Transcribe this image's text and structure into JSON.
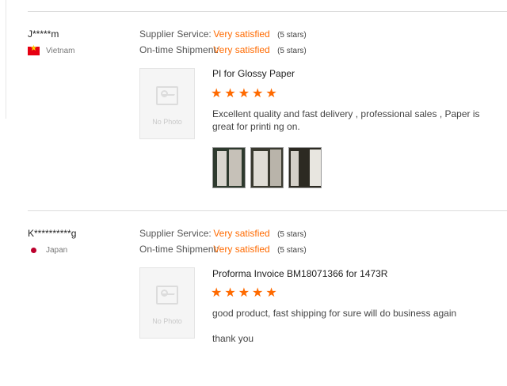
{
  "reviews": [
    {
      "buyer": "J*****m",
      "country": "Vietnam",
      "supplier_service_label": "Supplier Service:",
      "supplier_service_value": "Very satisfied",
      "supplier_service_stars": "(5 stars)",
      "shipment_label": "On-time Shipment:",
      "shipment_value": "Very satisfied",
      "shipment_stars": "(5 stars)",
      "no_photo": "No Photo",
      "product": "PI for Glossy Paper",
      "rating": 5,
      "comment": "Excellent quality and fast delivery , professional sales , Paper is great for printi ng on.",
      "photo_count": 3
    },
    {
      "buyer": "K**********g",
      "country": "Japan",
      "supplier_service_label": "Supplier Service:",
      "supplier_service_value": "Very satisfied",
      "supplier_service_stars": "(5 stars)",
      "shipment_label": "On-time Shipment:",
      "shipment_value": "Very satisfied",
      "shipment_stars": "(5 stars)",
      "no_photo": "No Photo",
      "product": "Proforma Invoice BM18071366 for 1473R",
      "rating": 5,
      "comment": "good product, fast shipping for sure will do business again",
      "comment2": "thank you"
    }
  ],
  "colors": {
    "accent": "#ff6a00",
    "divider": "#dcdcdc"
  }
}
